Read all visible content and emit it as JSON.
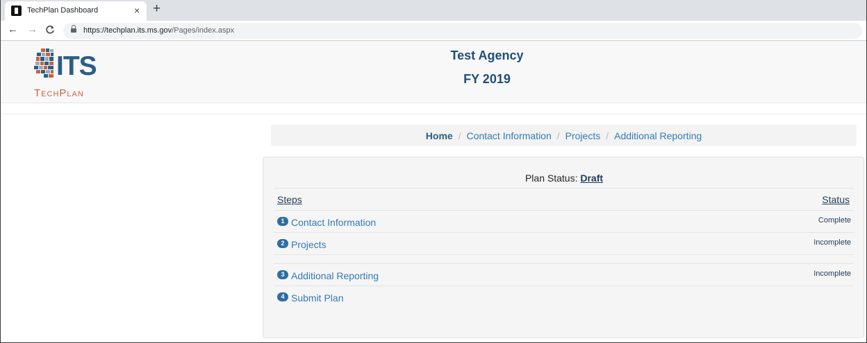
{
  "browser": {
    "tab_title": "TechPlan Dashboard",
    "close_glyph": "×",
    "newtab_glyph": "+",
    "url_host": "https://techplan.its.ms.gov",
    "url_path": "/Pages/index.aspx",
    "back_glyph": "←",
    "forward_glyph": "→",
    "reload_glyph": "C"
  },
  "header": {
    "logo_text": "ITS",
    "logo_subtext": "TechPlan",
    "agency": "Test Agency",
    "fiscal_year": "FY 2019"
  },
  "breadcrumb": {
    "items": [
      "Home",
      "Contact Information",
      "Projects",
      "Additional Reporting"
    ],
    "separator": "/"
  },
  "plan": {
    "status_label": "Plan Status:",
    "status_value": "Draft",
    "steps_header": "Steps",
    "status_header": "Status",
    "steps": [
      {
        "number": "1",
        "label": "Contact Information",
        "status": "Complete"
      },
      {
        "number": "2",
        "label": "Projects",
        "status": "Incomplete"
      },
      {
        "number": "3",
        "label": "Additional Reporting",
        "status": "Incomplete"
      },
      {
        "number": "4",
        "label": "Submit Plan",
        "status": ""
      }
    ]
  },
  "colors": {
    "brand_blue": "#2b5e86",
    "link_blue": "#337ab7",
    "brand_orange": "#c9623f",
    "badge_blue": "#2e6da4"
  }
}
